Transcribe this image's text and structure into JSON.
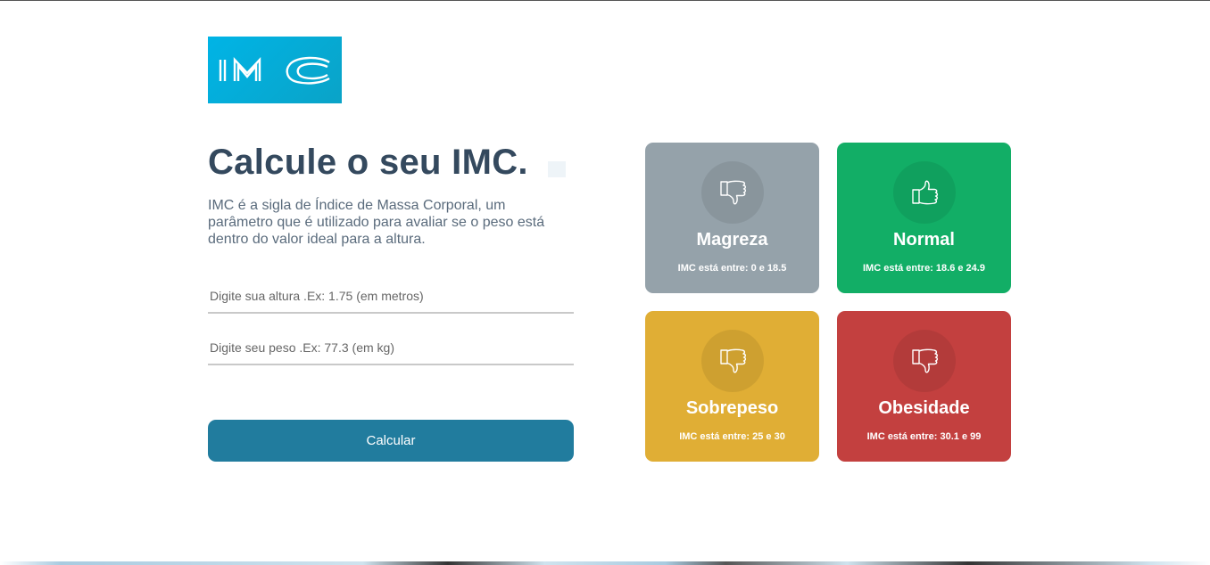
{
  "logo": {
    "text": "IMC",
    "colors": {
      "bg": "#00b4e6",
      "fg": "#ffffff"
    }
  },
  "page_title": "Calcule o seu IMC.",
  "description": "IMC é a sigla de Índice de Massa Corporal, um parâmetro que é utilizado para avaliar se o peso está dentro do valor ideal para a altura.",
  "form": {
    "height_placeholder": "Digite sua altura .Ex: 1.75 (em metros)",
    "weight_placeholder": "Digite seu peso .Ex: 77.3 (em kg)",
    "submit_label": "Calcular"
  },
  "categories": [
    {
      "name": "Magreza",
      "range_prefix": "IMC está entre: ",
      "range_values": "0 e 18.5",
      "icon": "thumbs-down-icon",
      "color": "#95a2aa"
    },
    {
      "name": "Normal",
      "range_prefix": "IMC está entre: ",
      "range_values": "18.6 e 24.9",
      "icon": "thumbs-up-icon",
      "color": "#12ae66"
    },
    {
      "name": "Sobrepeso",
      "range_prefix": "IMC está entre: ",
      "range_values": "25 e 30",
      "icon": "thumbs-down-icon",
      "color": "#e0ae35"
    },
    {
      "name": "Obesidade",
      "range_prefix": "IMC está entre: ",
      "range_values": "30.1 e 99",
      "icon": "thumbs-down-icon",
      "color": "#c3403f"
    }
  ],
  "colors": {
    "title": "#34495e",
    "button": "#217c9e"
  }
}
